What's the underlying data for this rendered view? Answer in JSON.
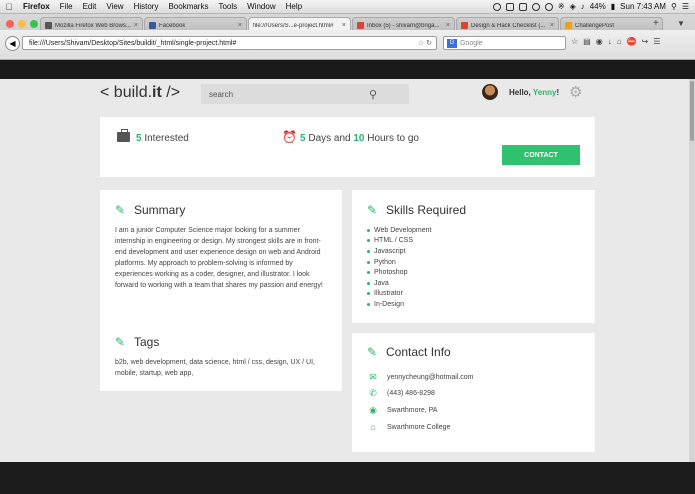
{
  "menubar": {
    "items": [
      "Firefox",
      "File",
      "Edit",
      "View",
      "History",
      "Bookmarks",
      "Tools",
      "Window",
      "Help"
    ],
    "battery": "44%",
    "clock": "Sun 7:43 AM"
  },
  "tabs": [
    {
      "title": "Mozilla Firefox Web Brows...",
      "favicon_color": "#555555"
    },
    {
      "title": "Facebook",
      "favicon_color": "#3b5998"
    },
    {
      "title": "file:///Users/S...e-project.html#",
      "favicon_color": "#dddddd"
    },
    {
      "title": "Inbox (5) - shivam@briga...",
      "favicon_color": "#d14836"
    },
    {
      "title": "Design & Hack Checklist (...",
      "favicon_color": "#d14836"
    },
    {
      "title": "ChallengePost",
      "favicon_color": "#e8a317"
    }
  ],
  "navbar": {
    "url": "file:///Users/Shivam/Desktop/Sites/buildit/_html/single-project.html#",
    "search_placeholder": "Google"
  },
  "site": {
    "logo_prefix": "< build.",
    "logo_bold": "it",
    "logo_suffix": " />",
    "search_placeholder": "search",
    "hello_prefix": "Hello, ",
    "user_name": "Yenny",
    "hello_suffix": "!"
  },
  "interest": {
    "count": "5",
    "label": " Interested",
    "days": "5",
    "days_label": " Days and ",
    "hours": "10",
    "hours_label": " Hours to go",
    "contact_button": "CONTACT"
  },
  "summary": {
    "title": "Summary",
    "text": "I am a junior Computer Science major looking for a summer internship in engineering or design. My strongest skills are in front-end development and user experience design on web and Android platforms. My approach to problem-solving is informed by experiences working as a coder, designer, and illustrator. I look forward to working with a team that shares my passion and energy!"
  },
  "skills": {
    "title": "Skills Required",
    "items": [
      "Web Development",
      "HTML / CSS",
      "Javascript",
      "Python",
      "Photoshop",
      "Java",
      "Illustrator",
      "In-Design"
    ]
  },
  "tags": {
    "title": "Tags",
    "text": "b2b, web development, data science, html / css, design, UX / UI, mobile, startup, web app,"
  },
  "contact": {
    "title": "Contact Info",
    "email": "yennycheung@hotmail.com",
    "phone": "(443) 486-8298",
    "location": "Swarthmore, PA",
    "school": "Swarthmore College"
  },
  "colors": {
    "accent": "#2fb36b",
    "button": "#2fc36f",
    "background": "#e9e9e9"
  }
}
